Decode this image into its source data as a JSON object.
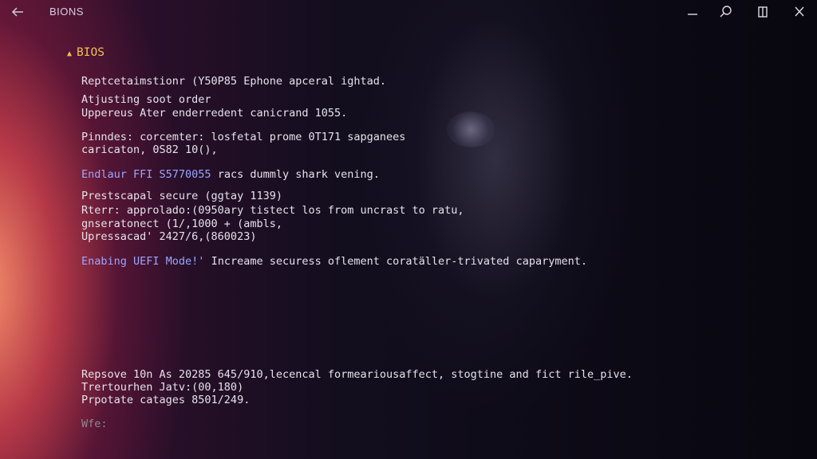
{
  "titlebar": {
    "title": "BIONS",
    "back_icon": "arrow-left-icon",
    "minimize_icon": "minimize-icon",
    "search_icon": "search-icon",
    "snap_icon": "snap-layout-icon",
    "close_icon": "close-icon"
  },
  "section": {
    "heading": "BIOS"
  },
  "lines": {
    "l1": "Reptcetaimstionr (Y50P85 Ephone apceral ightad.",
    "l2": "Atjusting soot order",
    "l3": "Uppereus Ater enderredent canicrand 1055.",
    "l4": "Pinndes: corcemter: losfetal prome 0T171 sapganees",
    "l5": "caricaton, 0S82 10(),",
    "l6a": "Endlaur FFI S5770055",
    "l6b": " racs dummly shark vening.",
    "l7": "Prestscapal secure (ggtay 1139)",
    "l8": "Rterr: approlado:(0950ary tistect los from uncrast to ratu,",
    "l9": "gnseratonect (1/,1000 + (ambls,",
    "l10": "Upressacad' 2427/6,(860023)",
    "l11a": "Enabing UEFI Mode!'",
    "l11b": " Increame securess oflement coratäller-trivated caparyment.",
    "l12": "Repsove 10n As 20285 645/910,lecencal formeariousaffect, stogtine and fict rile_pive.",
    "l13": "Trertourhen Jatv:(00,180)",
    "l14": "Prpotate catages 8501/249.",
    "l15": "Wfe:"
  },
  "colors": {
    "heading": "#f2c14e",
    "text": "#e6e2ea",
    "highlight": "#9aa6ff",
    "dim": "#8d8896"
  }
}
